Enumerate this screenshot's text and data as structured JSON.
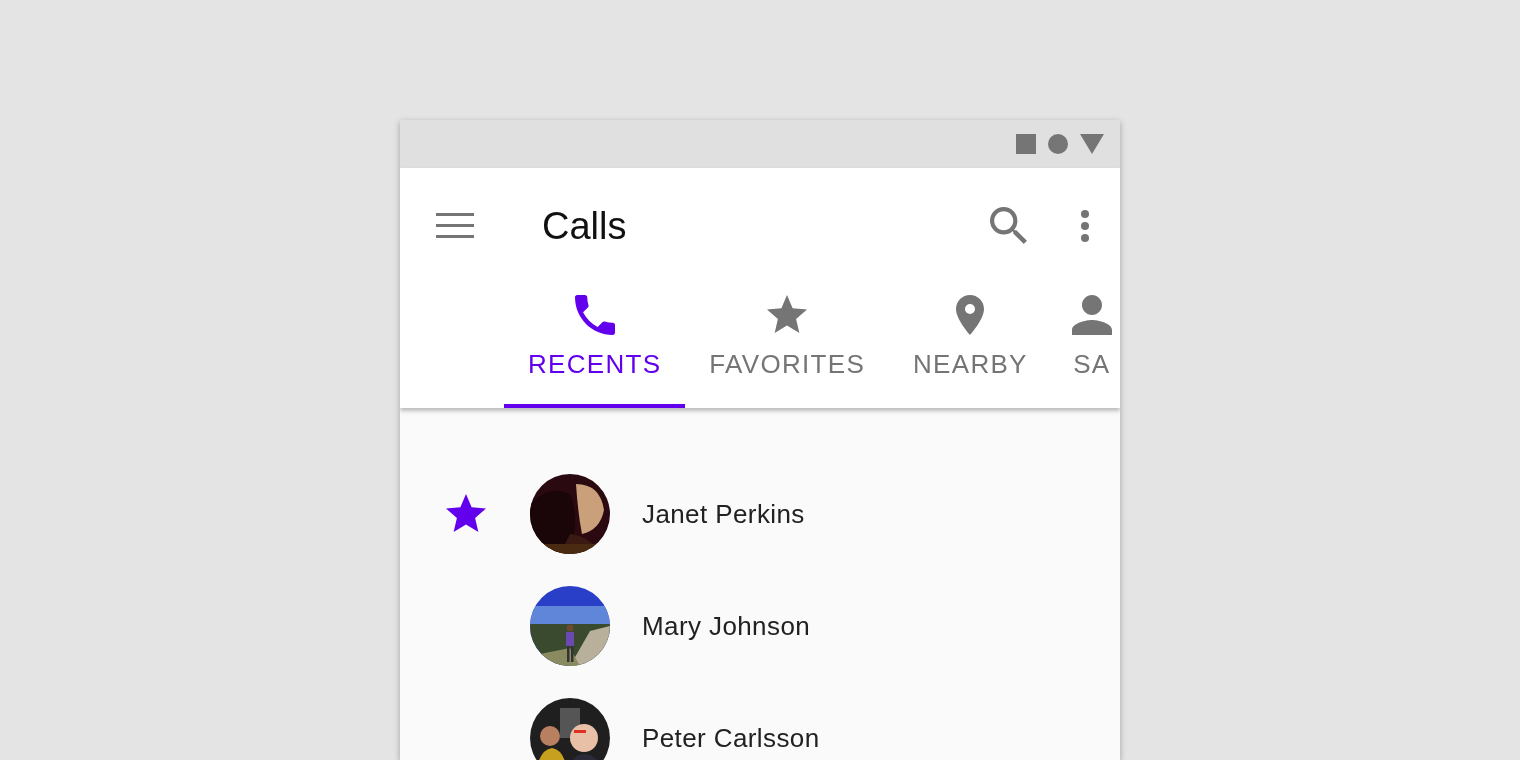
{
  "app_bar": {
    "title": "Calls"
  },
  "tabs": [
    {
      "label": "RECENTS",
      "selected": true
    },
    {
      "label": "FAVORITES",
      "selected": false
    },
    {
      "label": "NEARBY",
      "selected": false
    },
    {
      "label": "SA",
      "selected": false
    }
  ],
  "contacts": [
    {
      "name": "Janet Perkins",
      "favorite": true
    },
    {
      "name": "Mary Johnson",
      "favorite": false
    },
    {
      "name": "Peter Carlsson",
      "favorite": false
    }
  ]
}
